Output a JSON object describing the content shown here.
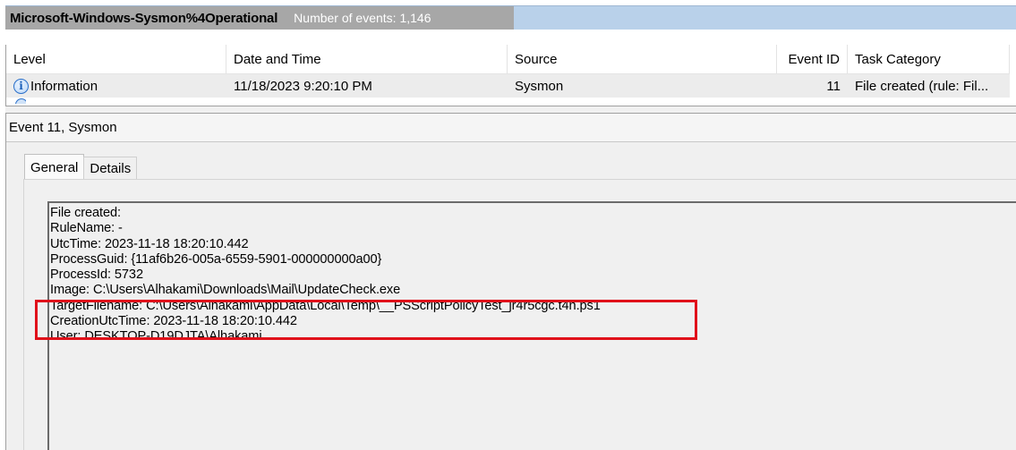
{
  "title": {
    "log_name": "Microsoft-Windows-Sysmon%4Operational",
    "event_count": "Number of events: 1,146"
  },
  "columns": {
    "level": "Level",
    "date_time": "Date and Time",
    "source": "Source",
    "event_id": "Event ID",
    "task_category": "Task Category"
  },
  "event_row": {
    "level": "Information",
    "date_time": "11/18/2023 9:20:10 PM",
    "source": "Sysmon",
    "event_id": "11",
    "task_category": "File created (rule: Fil..."
  },
  "detail": {
    "header": "Event 11, Sysmon",
    "tabs": [
      "General",
      "Details"
    ],
    "active_tab": "General",
    "lines": [
      "File created:",
      "RuleName: -",
      "UtcTime: 2023-11-18 18:20:10.442",
      "ProcessGuid: {11af6b26-005a-6559-5901-000000000a00}",
      "ProcessId: 5732",
      "Image: C:\\Users\\Alhakami\\Downloads\\Mail\\UpdateCheck.exe",
      "TargetFilename: C:\\Users\\Alhakami\\AppData\\Local\\Temp\\__PSScriptPolicyTest_jr4r5cgc.t4n.ps1",
      "CreationUtcTime: 2023-11-18 18:20:10.442",
      "User: DESKTOP-D19DJTA\\Alhakami"
    ]
  },
  "icons": {
    "level_icon": "info-icon"
  },
  "colors": {
    "highlight": "#e0101a",
    "title_block": "#a7a7a7",
    "title_bar": "#b9d1ea",
    "info_icon": "#2a6fc9"
  }
}
